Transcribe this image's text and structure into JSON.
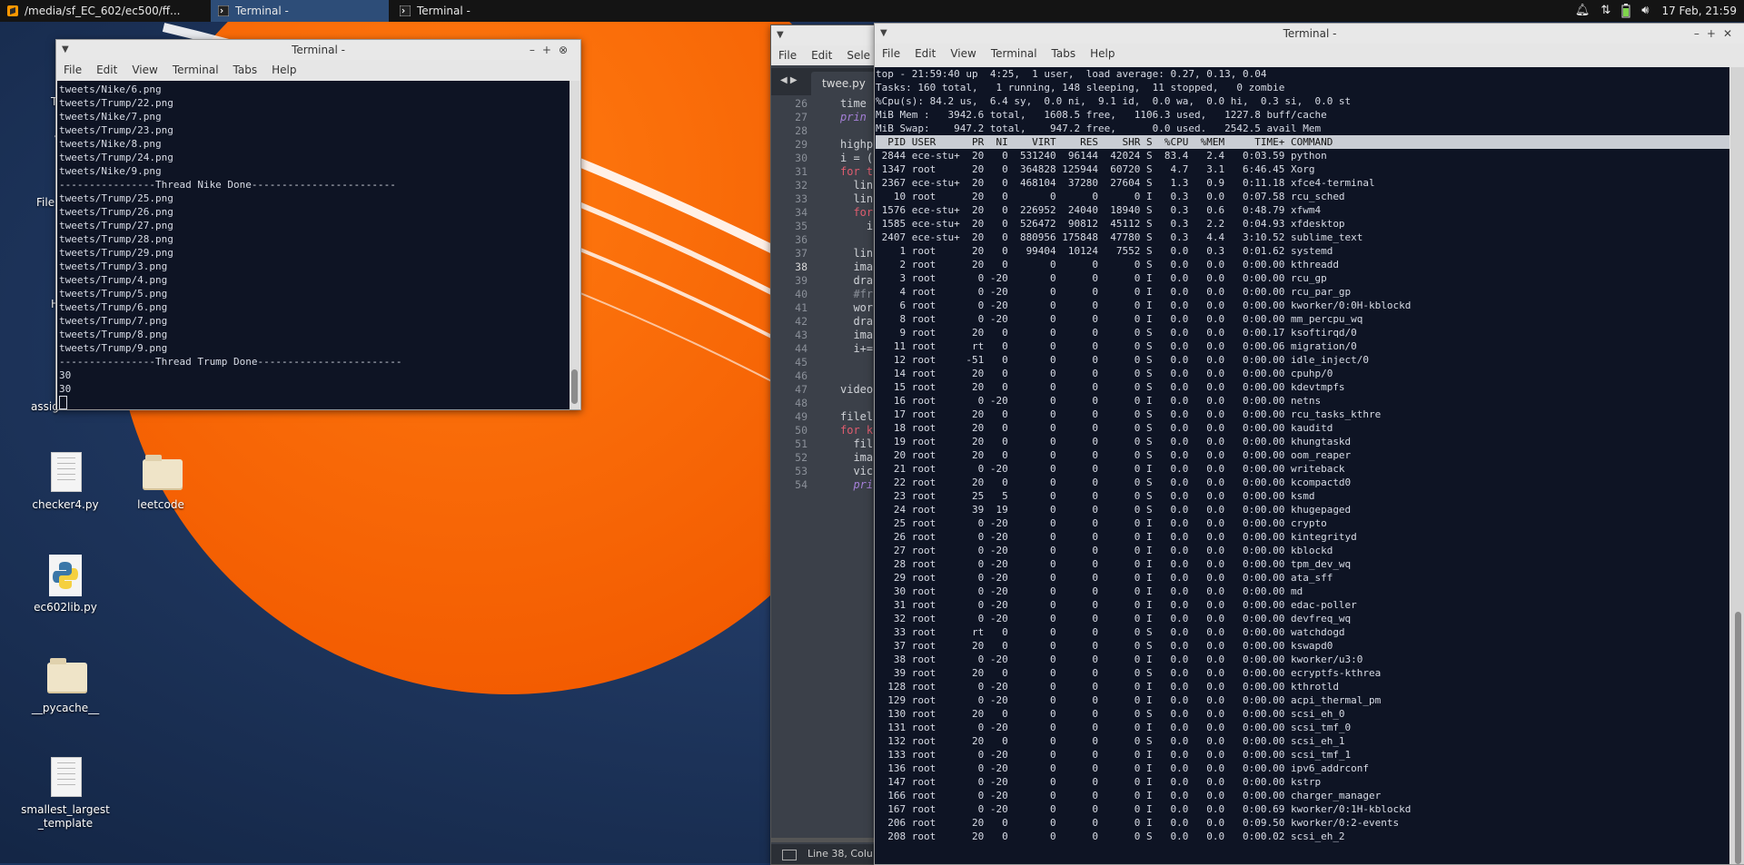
{
  "panel": {
    "task_sublime": "/media/sf_EC_602/ec500/ff...",
    "task_term1": "Terminal -",
    "task_term2": "Terminal -",
    "clock": "17 Feb, 21:59"
  },
  "desktop": {
    "icons": [
      {
        "label": "checker4.py",
        "type": "text-file"
      },
      {
        "label": "leetcode",
        "type": "folder"
      },
      {
        "label": "ec602lib.py",
        "type": "python-file"
      },
      {
        "label": "__pycache__",
        "type": "folder"
      },
      {
        "label": "smallest_largest\n_template",
        "type": "text-file"
      }
    ],
    "partial_labels": [
      "T",
      "File",
      "H",
      "assig"
    ]
  },
  "terminal1": {
    "title": "Terminal -",
    "menu": [
      "File",
      "Edit",
      "View",
      "Terminal",
      "Tabs",
      "Help"
    ],
    "lines": [
      "tweets/Nike/6.png",
      "tweets/Trump/22.png",
      "tweets/Nike/7.png",
      "tweets/Trump/23.png",
      "tweets/Nike/8.png",
      "tweets/Trump/24.png",
      "tweets/Nike/9.png",
      "----------------Thread Nike Done------------------------",
      "tweets/Trump/25.png",
      "tweets/Trump/26.png",
      "tweets/Trump/27.png",
      "tweets/Trump/28.png",
      "tweets/Trump/29.png",
      "tweets/Trump/3.png",
      "tweets/Trump/4.png",
      "tweets/Trump/5.png",
      "tweets/Trump/6.png",
      "tweets/Trump/7.png",
      "tweets/Trump/8.png",
      "tweets/Trump/9.png",
      "----------------Thread Trump Done------------------------",
      "30",
      "30"
    ]
  },
  "sublime": {
    "menu": [
      "File",
      "Edit",
      "Sele"
    ],
    "tab": "twee.py",
    "line_numbers": [
      "26",
      "27",
      "28",
      "29",
      "30",
      "31",
      "32",
      "33",
      "34",
      "35",
      "36",
      "37",
      "38",
      "39",
      "40",
      "41",
      "42",
      "43",
      "44",
      "45",
      "46",
      "47",
      "48",
      "49",
      "50",
      "51",
      "52",
      "53",
      "54"
    ],
    "code": [
      "time",
      "prin",
      "",
      "highp",
      "i = (",
      "for t",
      "  lin",
      "  lin",
      "  for",
      "    i",
      "",
      "  lin",
      "  ima",
      "  dra",
      "  #fr",
      "  wor",
      "  dra",
      "  ima",
      "  i+=",
      "",
      "",
      "video",
      "",
      "filel",
      "for k",
      "  fil",
      "  ima",
      "  vic",
      "  pri"
    ],
    "status": "Line 38, Colu"
  },
  "terminal2": {
    "title": "Terminal -",
    "menu": [
      "File",
      "Edit",
      "View",
      "Terminal",
      "Tabs",
      "Help"
    ],
    "summary": [
      "top - 21:59:40 up  4:25,  1 user,  load average: 0.27, 0.13, 0.04",
      "Tasks: 160 total,   1 running, 148 sleeping,  11 stopped,   0 zombie",
      "%Cpu(s): 84.2 us,  6.4 sy,  0.0 ni,  9.1 id,  0.0 wa,  0.0 hi,  0.3 si,  0.0 st",
      "MiB Mem :   3942.6 total,   1608.5 free,   1106.3 used,   1227.8 buff/cache",
      "MiB Swap:    947.2 total,    947.2 free,      0.0 used.   2542.5 avail Mem",
      ""
    ],
    "header": "  PID USER      PR  NI    VIRT    RES    SHR S  %CPU  %MEM     TIME+ COMMAND                                                                                       ",
    "processes": [
      " 2844 ece-stu+  20   0  531240  96144  42024 S  83.4   2.4   0:03.59 python",
      " 1347 root      20   0  364828 125944  60720 S   4.7   3.1   6:46.45 Xorg",
      " 2367 ece-stu+  20   0  468104  37280  27604 S   1.3   0.9   0:11.18 xfce4-terminal",
      "   10 root      20   0       0      0      0 I   0.3   0.0   0:07.58 rcu_sched",
      " 1576 ece-stu+  20   0  226952  24040  18940 S   0.3   0.6   0:48.79 xfwm4",
      " 1585 ece-stu+  20   0  526472  90812  45112 S   0.3   2.2   0:04.93 xfdesktop",
      " 2407 ece-stu+  20   0  880956 175848  47780 S   0.3   4.4   3:10.52 sublime_text",
      "    1 root      20   0   99404  10124   7552 S   0.0   0.3   0:01.62 systemd",
      "    2 root      20   0       0      0      0 S   0.0   0.0   0:00.00 kthreadd",
      "    3 root       0 -20       0      0      0 I   0.0   0.0   0:00.00 rcu_gp",
      "    4 root       0 -20       0      0      0 I   0.0   0.0   0:00.00 rcu_par_gp",
      "    6 root       0 -20       0      0      0 I   0.0   0.0   0:00.00 kworker/0:0H-kblockd",
      "    8 root       0 -20       0      0      0 I   0.0   0.0   0:00.00 mm_percpu_wq",
      "    9 root      20   0       0      0      0 S   0.0   0.0   0:00.17 ksoftirqd/0",
      "   11 root      rt   0       0      0      0 S   0.0   0.0   0:00.06 migration/0",
      "   12 root     -51   0       0      0      0 S   0.0   0.0   0:00.00 idle_inject/0",
      "   14 root      20   0       0      0      0 S   0.0   0.0   0:00.00 cpuhp/0",
      "   15 root      20   0       0      0      0 S   0.0   0.0   0:00.00 kdevtmpfs",
      "   16 root       0 -20       0      0      0 I   0.0   0.0   0:00.00 netns",
      "   17 root      20   0       0      0      0 S   0.0   0.0   0:00.00 rcu_tasks_kthre",
      "   18 root      20   0       0      0      0 S   0.0   0.0   0:00.00 kauditd",
      "   19 root      20   0       0      0      0 S   0.0   0.0   0:00.00 khungtaskd",
      "   20 root      20   0       0      0      0 S   0.0   0.0   0:00.00 oom_reaper",
      "   21 root       0 -20       0      0      0 I   0.0   0.0   0:00.00 writeback",
      "   22 root      20   0       0      0      0 S   0.0   0.0   0:00.00 kcompactd0",
      "   23 root      25   5       0      0      0 S   0.0   0.0   0:00.00 ksmd",
      "   24 root      39  19       0      0      0 S   0.0   0.0   0:00.00 khugepaged",
      "   25 root       0 -20       0      0      0 I   0.0   0.0   0:00.00 crypto",
      "   26 root       0 -20       0      0      0 I   0.0   0.0   0:00.00 kintegrityd",
      "   27 root       0 -20       0      0      0 I   0.0   0.0   0:00.00 kblockd",
      "   28 root       0 -20       0      0      0 I   0.0   0.0   0:00.00 tpm_dev_wq",
      "   29 root       0 -20       0      0      0 I   0.0   0.0   0:00.00 ata_sff",
      "   30 root       0 -20       0      0      0 I   0.0   0.0   0:00.00 md",
      "   31 root       0 -20       0      0      0 I   0.0   0.0   0:00.00 edac-poller",
      "   32 root       0 -20       0      0      0 I   0.0   0.0   0:00.00 devfreq_wq",
      "   33 root      rt   0       0      0      0 S   0.0   0.0   0:00.00 watchdogd",
      "   37 root      20   0       0      0      0 S   0.0   0.0   0:00.00 kswapd0",
      "   38 root       0 -20       0      0      0 I   0.0   0.0   0:00.00 kworker/u3:0",
      "   39 root      20   0       0      0      0 S   0.0   0.0   0:00.00 ecryptfs-kthrea",
      "  128 root       0 -20       0      0      0 I   0.0   0.0   0:00.00 kthrotld",
      "  129 root       0 -20       0      0      0 I   0.0   0.0   0:00.00 acpi_thermal_pm",
      "  130 root      20   0       0      0      0 S   0.0   0.0   0:00.00 scsi_eh_0",
      "  131 root       0 -20       0      0      0 I   0.0   0.0   0:00.00 scsi_tmf_0",
      "  132 root      20   0       0      0      0 S   0.0   0.0   0:00.00 scsi_eh_1",
      "  133 root       0 -20       0      0      0 I   0.0   0.0   0:00.00 scsi_tmf_1",
      "  136 root       0 -20       0      0      0 I   0.0   0.0   0:00.00 ipv6_addrconf",
      "  147 root       0 -20       0      0      0 I   0.0   0.0   0:00.00 kstrp",
      "  166 root       0 -20       0      0      0 I   0.0   0.0   0:00.00 charger_manager",
      "  167 root       0 -20       0      0      0 I   0.0   0.0   0:00.69 kworker/0:1H-kblockd",
      "  206 root      20   0       0      0      0 I   0.0   0.0   0:09.50 kworker/0:2-events",
      "  208 root      20   0       0      0      0 S   0.0   0.0   0:00.02 scsi_eh_2"
    ]
  },
  "colors": {
    "panel": "#141414",
    "terminal_bg": "#0e1424",
    "terminal_fg": "#d8dce6",
    "wallpaper_orange": "#ff6a00",
    "wallpaper_blue": "#1b3560"
  }
}
